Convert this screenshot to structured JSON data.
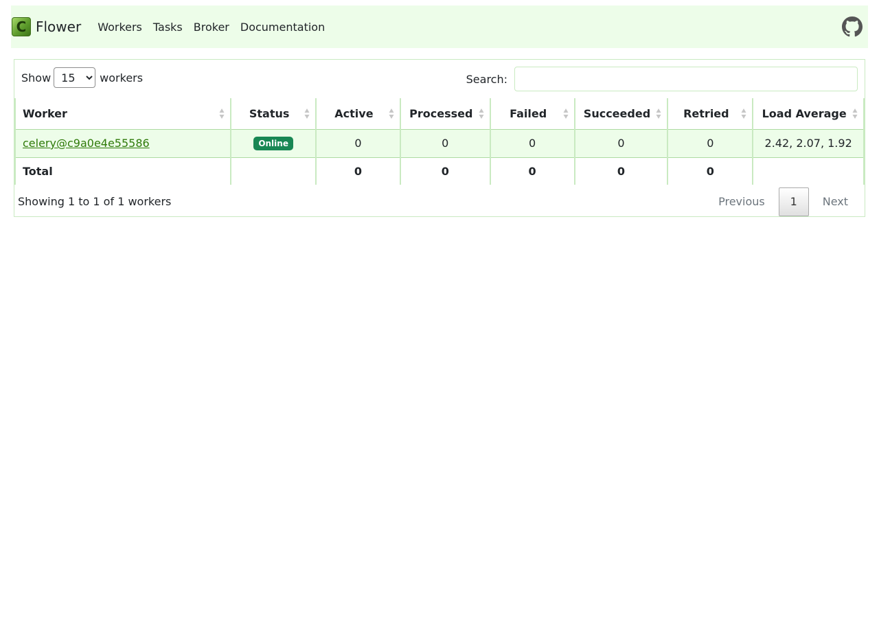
{
  "navbar": {
    "brand": "Flower",
    "links": [
      "Workers",
      "Tasks",
      "Broker",
      "Documentation"
    ]
  },
  "controls": {
    "show_label": "Show",
    "length_value": "15",
    "workers_label": "workers",
    "search_label": "Search:",
    "search_value": ""
  },
  "table": {
    "columns": [
      "Worker",
      "Status",
      "Active",
      "Processed",
      "Failed",
      "Succeeded",
      "Retried",
      "Load Average"
    ],
    "rows": [
      {
        "worker": "celery@c9a0e4e55586",
        "status": "Online",
        "active": "0",
        "processed": "0",
        "failed": "0",
        "succeeded": "0",
        "retried": "0",
        "load_average": "2.42, 2.07, 1.92"
      }
    ],
    "total": {
      "label": "Total",
      "active": "0",
      "processed": "0",
      "failed": "0",
      "succeeded": "0",
      "retried": "0"
    }
  },
  "footer": {
    "info": "Showing 1 to 1 of 1 workers",
    "previous": "Previous",
    "current_page": "1",
    "next": "Next"
  },
  "colors": {
    "navbar_bg": "#edfde9",
    "row_bg": "#edfde9",
    "border": "#c9eac1",
    "link": "#2f7a09",
    "status_online": "#198754"
  }
}
